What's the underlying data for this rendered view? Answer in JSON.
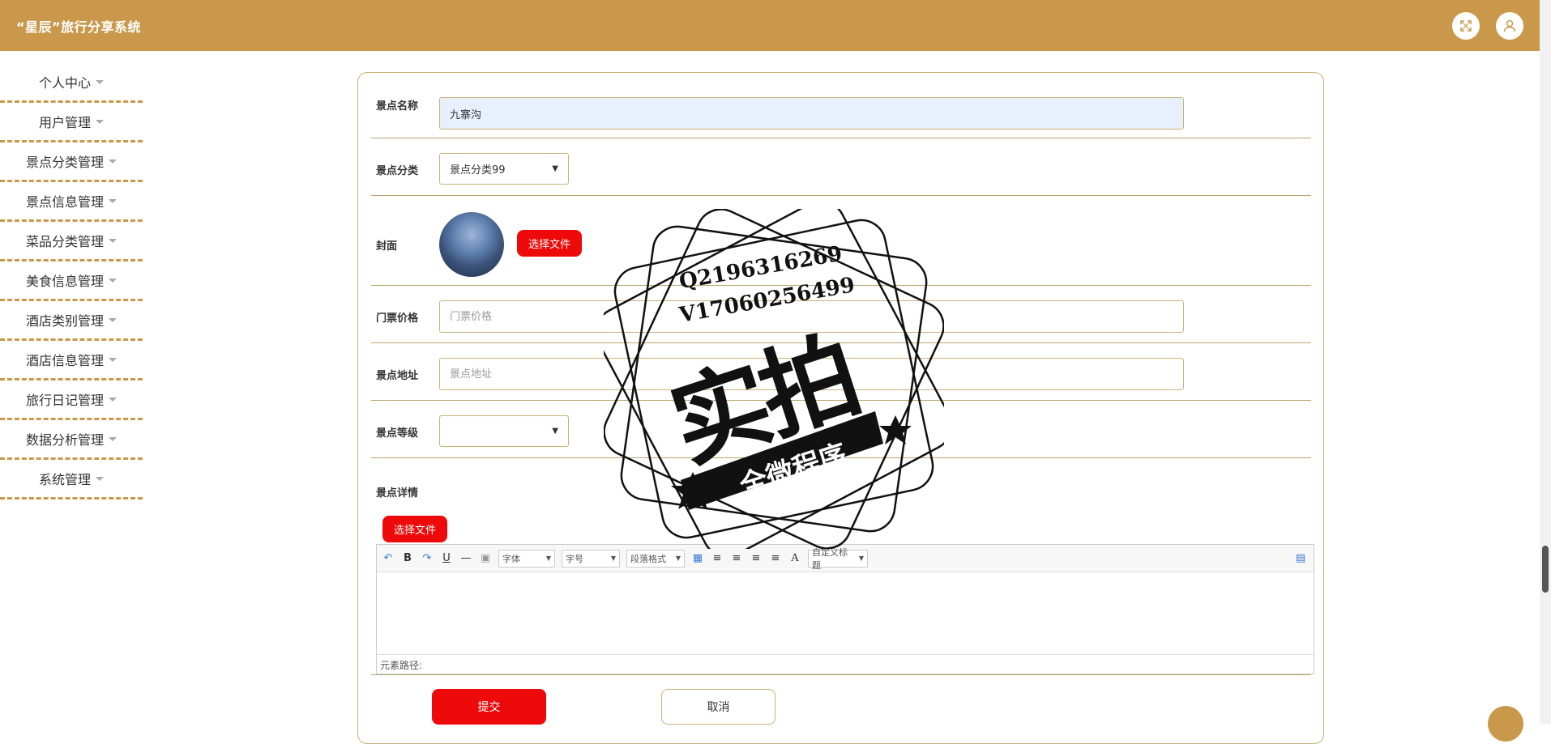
{
  "header": {
    "title": "“星辰”旅行分享系统",
    "icons": [
      "fullscreen-icon",
      "user-icon"
    ]
  },
  "sidebar": {
    "items": [
      {
        "label": "个人中心"
      },
      {
        "label": "用户管理"
      },
      {
        "label": "景点分类管理"
      },
      {
        "label": "景点信息管理"
      },
      {
        "label": "菜品分类管理"
      },
      {
        "label": "美食信息管理"
      },
      {
        "label": "酒店类别管理"
      },
      {
        "label": "酒店信息管理"
      },
      {
        "label": "旅行日记管理"
      },
      {
        "label": "数据分析管理"
      },
      {
        "label": "系统管理"
      }
    ]
  },
  "form": {
    "name_label": "景点名称",
    "name_value": "九寨沟",
    "category_label": "景点分类",
    "category_value": "景点分类99",
    "cover_label": "封面",
    "cover_button": "选择文件",
    "price_label": "门票价格",
    "price_placeholder": "门票价格",
    "address_label": "景点地址",
    "address_placeholder": "景点地址",
    "level_label": "景点等级",
    "level_value": "",
    "detail_label": "景点详情",
    "detail_button": "选择文件",
    "submit_label": "提交",
    "cancel_label": "取消"
  },
  "editor": {
    "font_combo": "字体",
    "size_combo": "字号",
    "paragraph_combo": "段落格式",
    "title_combo": "自定义标题",
    "status_label": "元素路径:"
  },
  "watermark": {
    "line1": "Q2196316269",
    "line2": "V17060256499",
    "main": "实拍",
    "banner": "全微程序"
  },
  "colors": {
    "header": "#c9984b",
    "accent_red": "#ee0a0a",
    "border": "#c9b37a"
  }
}
